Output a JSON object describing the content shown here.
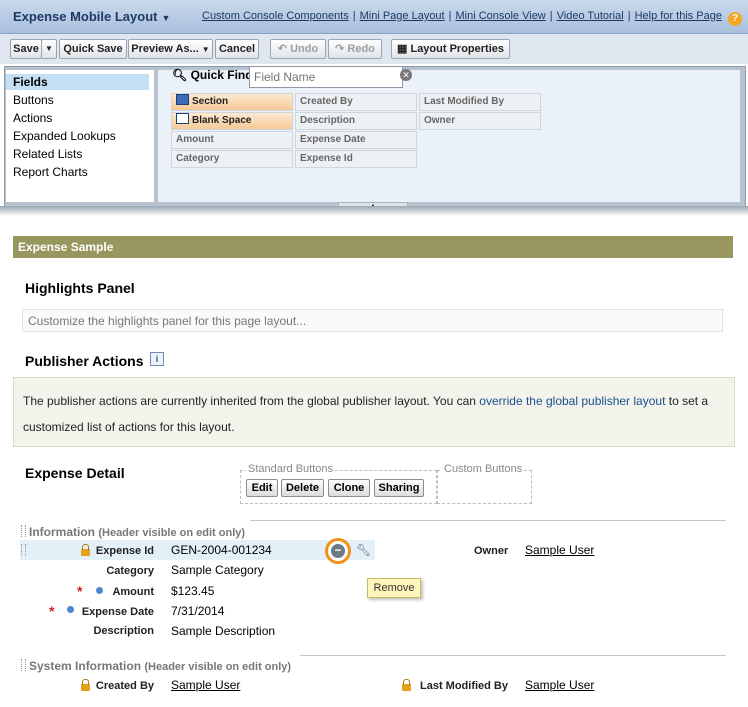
{
  "header": {
    "layout_title": "Expense Mobile Layout",
    "links": [
      "Custom Console Components",
      "Mini Page Layout",
      "Mini Console View",
      "Video Tutorial",
      "Help for this Page"
    ],
    "help_icon": "?"
  },
  "toolbar": {
    "save": "Save",
    "save_menu": "▼",
    "quick_save": "Quick Save",
    "preview": "Preview As...",
    "cancel": "Cancel",
    "undo": "Undo",
    "redo": "Redo",
    "layout_properties": "Layout Properties"
  },
  "palette": {
    "nav": [
      "Fields",
      "Buttons",
      "Actions",
      "Expanded Lookups",
      "Related Lists",
      "Report Charts"
    ],
    "active_nav": "Fields",
    "quick_find_label": "Quick Find",
    "quick_find_placeholder": "Field Name",
    "fields": [
      "Section",
      "Created By",
      "Last Modified By",
      "Blank Space",
      "Description",
      "Owner",
      "Amount",
      "Expense Date",
      "Category",
      "Expense Id"
    ]
  },
  "layout": {
    "section_header": "Expense Sample",
    "highlights_title": "Highlights Panel",
    "highlights_placeholder": "Customize the highlights panel for this page layout...",
    "publisher_title": "Publisher Actions",
    "publisher_info_icon": "i",
    "publisher_text_before": "The publisher actions are currently inherited from the global publisher layout. You can ",
    "publisher_link": "override the global publisher layout",
    "publisher_text_after": " to set a customized list of actions for this layout.",
    "detail_title": "Expense Detail",
    "standard_buttons_label": "Standard Buttons",
    "custom_buttons_label": "Custom Buttons",
    "standard_buttons": [
      "Edit",
      "Delete",
      "Clone",
      "Sharing"
    ]
  },
  "information": {
    "title": "Information",
    "subtitle": "(Header visible on edit only)",
    "fields": [
      {
        "label": "Expense Id",
        "value": "GEN-2004-001234"
      },
      {
        "label": "Category",
        "value": "Sample Category"
      },
      {
        "label": "Amount",
        "value": "$123.45"
      },
      {
        "label": "Expense Date",
        "value": "7/31/2014"
      },
      {
        "label": "Description",
        "value": "Sample Description"
      }
    ],
    "owner_label": "Owner",
    "owner_value": "Sample User",
    "required_mark": "*",
    "remove_tooltip": "Remove"
  },
  "system_information": {
    "title": "System Information",
    "subtitle": "(Header visible on edit only)",
    "created_by_label": "Created By",
    "created_by_value": "Sample User",
    "last_modified_label": "Last Modified By",
    "last_modified_value": "Sample User"
  },
  "colors": {
    "accent": "#f29018",
    "section_header": "#97975f",
    "link": "#1a4f8a"
  }
}
